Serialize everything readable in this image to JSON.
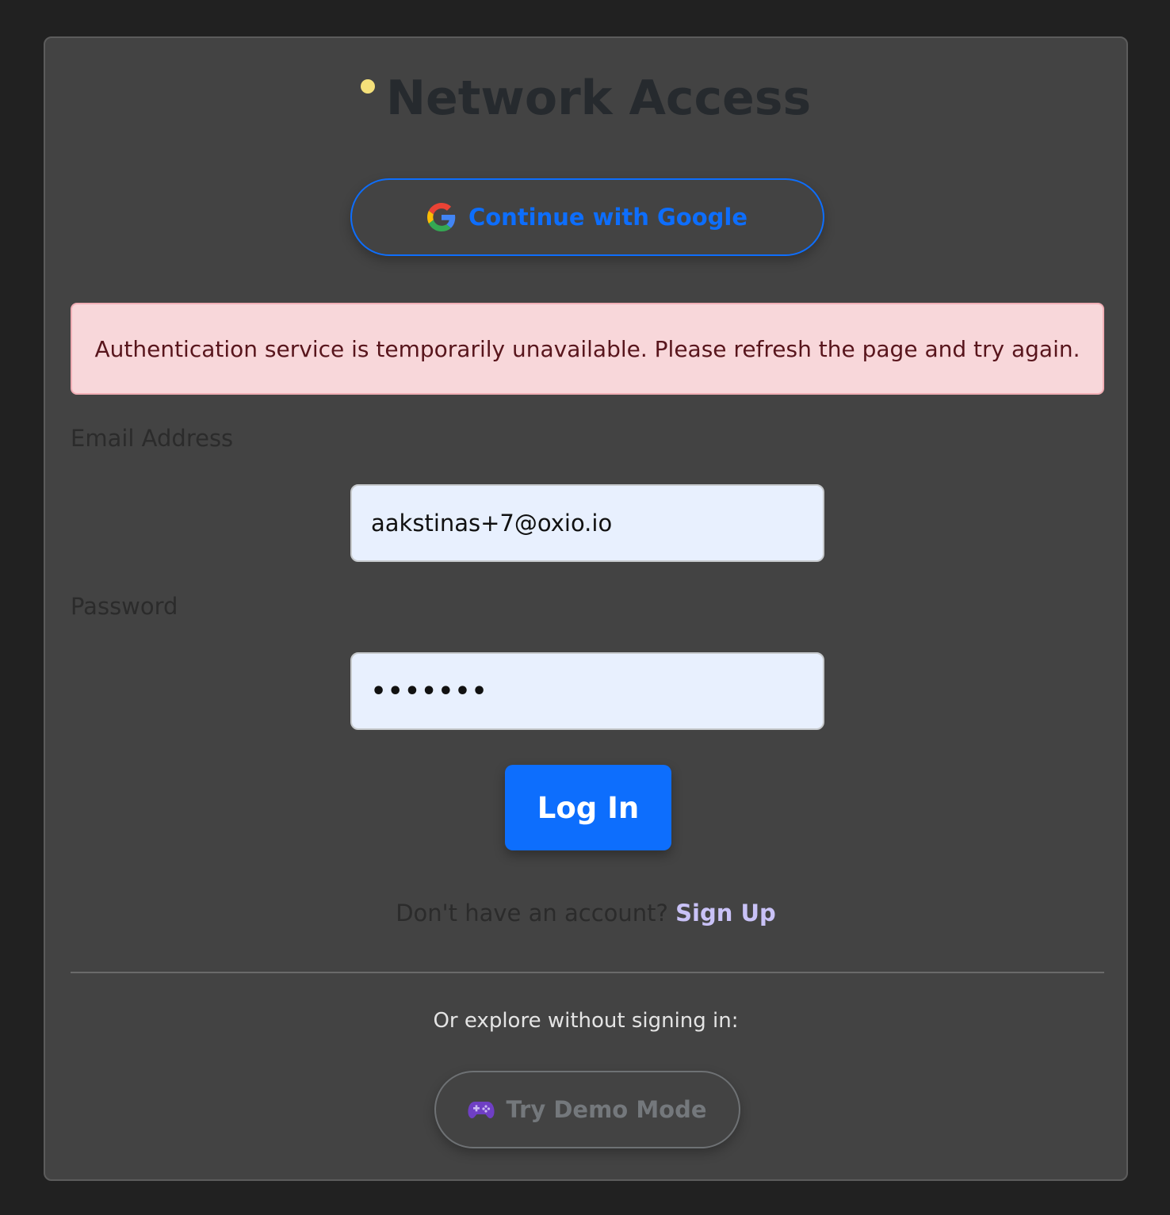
{
  "header": {
    "title": "Network Access",
    "status_dot_color": "#f4e07a"
  },
  "google_button": {
    "label": "Continue with Google",
    "icon": "google-icon"
  },
  "alert": {
    "message": "Authentication service is temporarily unavailable. Please refresh the page and try again."
  },
  "form": {
    "email_label": "Email Address",
    "email_value": "aakstinas+7@oxio.io",
    "password_label": "Password",
    "password_value": "•••••••",
    "submit_label": "Log In"
  },
  "signup": {
    "prompt": "Don't have an account?",
    "link_label": "Sign Up"
  },
  "explore": {
    "text": "Or explore without signing in:",
    "demo_label": "Try Demo Mode",
    "demo_icon": "gamepad-icon"
  },
  "colors": {
    "accent": "#0d6efd",
    "alert_bg": "#f8d7da",
    "alert_text": "#58151c"
  }
}
